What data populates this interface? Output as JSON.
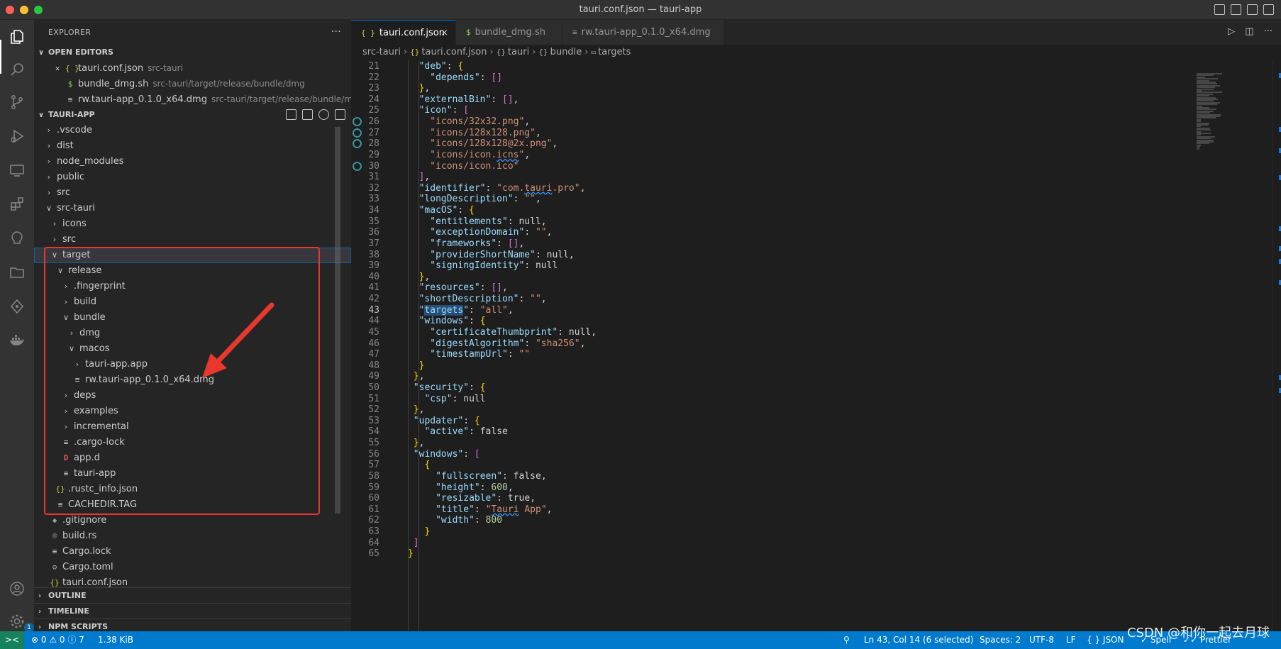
{
  "window": {
    "title": "tauri.conf.json — tauri-app"
  },
  "explorer": {
    "title": "EXPLORER",
    "more": "···",
    "open_editors_label": "OPEN EDITORS",
    "open_editors": [
      {
        "close": "×",
        "icon": "{ }",
        "name": "tauri.conf.json",
        "desc": "src-tauri"
      },
      {
        "icon": "$",
        "name": "bundle_dmg.sh",
        "desc": "src-tauri/target/release/bundle/dmg"
      },
      {
        "icon": "≡",
        "name": "rw.tauri-app_0.1.0_x64.dmg",
        "desc": "src-tauri/target/release/bundle/mac..."
      }
    ],
    "workspace_label": "TAURI-APP",
    "tree": [
      {
        "name": ".vscode"
      },
      {
        "name": "dist"
      },
      {
        "name": "node_modules"
      },
      {
        "name": "public"
      },
      {
        "name": "src"
      },
      {
        "name": "src-tauri"
      },
      {
        "name": "icons"
      },
      {
        "name": "src"
      },
      {
        "name": "target"
      },
      {
        "name": "release"
      },
      {
        "name": ".fingerprint"
      },
      {
        "name": "build"
      },
      {
        "name": "bundle"
      },
      {
        "name": "dmg"
      },
      {
        "name": "macos"
      },
      {
        "name": "tauri-app.app"
      },
      {
        "name": "rw.tauri-app_0.1.0_x64.dmg"
      },
      {
        "name": "deps"
      },
      {
        "name": "examples"
      },
      {
        "name": "incremental"
      },
      {
        "name": ".cargo-lock"
      },
      {
        "name": "app.d"
      },
      {
        "name": "tauri-app"
      },
      {
        "name": ".rustc_info.json"
      },
      {
        "name": "CACHEDIR.TAG"
      },
      {
        "name": ".gitignore"
      },
      {
        "name": "build.rs"
      },
      {
        "name": "Cargo.lock"
      },
      {
        "name": "Cargo.toml"
      },
      {
        "name": "tauri.conf.json"
      }
    ],
    "bottom_sections": [
      "OUTLINE",
      "TIMELINE",
      "NPM SCRIPTS"
    ]
  },
  "tabs": [
    {
      "icon": "{ }",
      "label": "tauri.conf.json",
      "close": "×"
    },
    {
      "icon": "$",
      "label": "bundle_dmg.sh"
    },
    {
      "icon": "≡",
      "label": "rw.tauri-app_0.1.0_x64.dmg"
    }
  ],
  "breadcrumb": [
    "src-tauri",
    "tauri.conf.json",
    "tauri",
    "bundle",
    "targets"
  ],
  "code": {
    "current_line": 43,
    "lines": [
      {
        "n": 21,
        "t": "\"deb\": {"
      },
      {
        "n": 22,
        "t": "  \"depends\": []"
      },
      {
        "n": 23,
        "t": "},"
      },
      {
        "n": 24,
        "t": "\"externalBin\": [],"
      },
      {
        "n": 25,
        "t": "\"icon\": ["
      },
      {
        "n": 26,
        "t": "  \"icons/32x32.png\","
      },
      {
        "n": 27,
        "t": "  \"icons/128x128.png\","
      },
      {
        "n": 28,
        "t": "  \"icons/128x128@2x.png\","
      },
      {
        "n": 29,
        "t": "  \"icons/icon.icns\","
      },
      {
        "n": 30,
        "t": "  \"icons/icon.ico\""
      },
      {
        "n": 31,
        "t": "],"
      },
      {
        "n": 32,
        "t": "\"identifier\": \"com.tauri.pro\","
      },
      {
        "n": 33,
        "t": "\"longDescription\": \"\","
      },
      {
        "n": 34,
        "t": "\"macOS\": {"
      },
      {
        "n": 35,
        "t": "  \"entitlements\": null,"
      },
      {
        "n": 36,
        "t": "  \"exceptionDomain\": \"\","
      },
      {
        "n": 37,
        "t": "  \"frameworks\": [],"
      },
      {
        "n": 38,
        "t": "  \"providerShortName\": null,"
      },
      {
        "n": 39,
        "t": "  \"signingIdentity\": null"
      },
      {
        "n": 40,
        "t": "},"
      },
      {
        "n": 41,
        "t": "\"resources\": [],"
      },
      {
        "n": 42,
        "t": "\"shortDescription\": \"\","
      },
      {
        "n": 43,
        "t": "\"targets\": \"all\","
      },
      {
        "n": 44,
        "t": "\"windows\": {"
      },
      {
        "n": 45,
        "t": "  \"certificateThumbprint\": null,"
      },
      {
        "n": 46,
        "t": "  \"digestAlgorithm\": \"sha256\","
      },
      {
        "n": 47,
        "t": "  \"timestampUrl\": \"\""
      },
      {
        "n": 48,
        "t": "}"
      },
      {
        "n": 49,
        "t": "},"
      },
      {
        "n": 50,
        "t": "\"security\": {"
      },
      {
        "n": 51,
        "t": "  \"csp\": null"
      },
      {
        "n": 52,
        "t": "},"
      },
      {
        "n": 53,
        "t": "\"updater\": {"
      },
      {
        "n": 54,
        "t": "  \"active\": false"
      },
      {
        "n": 55,
        "t": "},"
      },
      {
        "n": 56,
        "t": "\"windows\": ["
      },
      {
        "n": 57,
        "t": "  {"
      },
      {
        "n": 58,
        "t": "    \"fullscreen\": false,"
      },
      {
        "n": 59,
        "t": "    \"height\": 600,"
      },
      {
        "n": 60,
        "t": "    \"resizable\": true,"
      },
      {
        "n": 61,
        "t": "    \"title\": \"Tauri App\","
      },
      {
        "n": 62,
        "t": "    \"width\": 800"
      },
      {
        "n": 63,
        "t": "  }"
      },
      {
        "n": 64,
        "t": "]"
      },
      {
        "n": 65,
        "t": "}"
      }
    ]
  },
  "status": {
    "remote": "><",
    "problems": "⊗ 0 ⚠ 0 ⓘ 7",
    "size": "1.38 KiB",
    "position": "Ln 43, Col 14 (6 selected)",
    "spaces": "Spaces: 2",
    "encoding": "UTF-8",
    "eol": "LF",
    "language": "{ }  JSON",
    "spell": "✓ Spell",
    "prettier": "✓✓ Prettier"
  },
  "watermark": "CSDN @和你一起去月球",
  "colors": {
    "accent": "#007acc",
    "highlight_box": "#e8382e",
    "arrow": "#e8382e"
  }
}
